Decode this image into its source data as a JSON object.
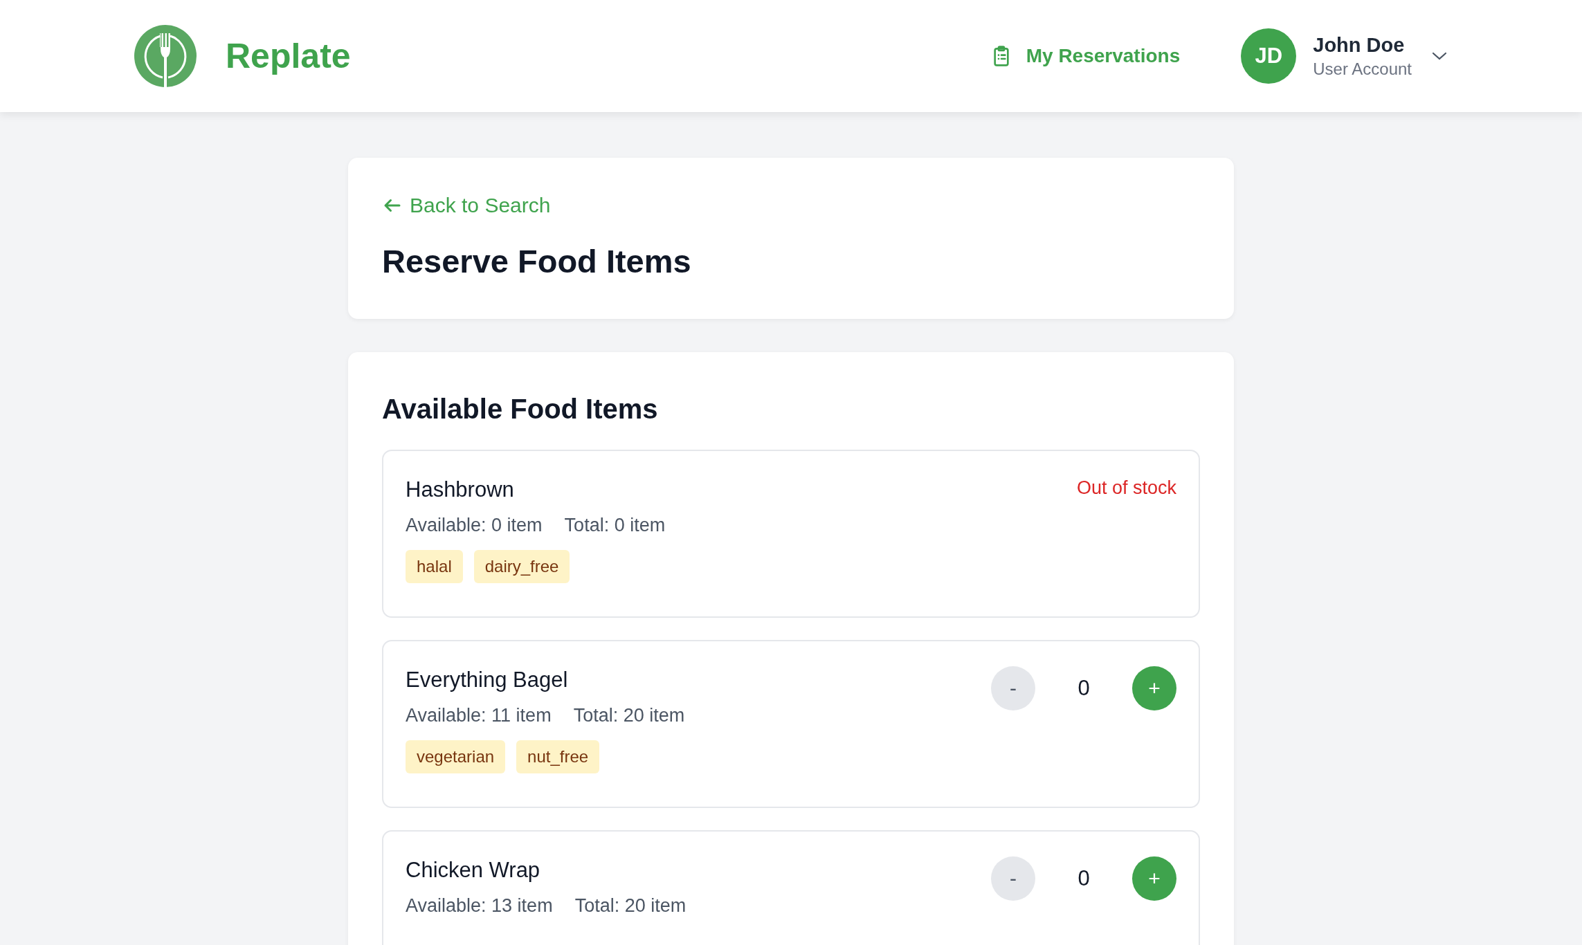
{
  "header": {
    "brand": "Replate",
    "nav_link": "My Reservations",
    "user": {
      "initials": "JD",
      "name": "John Doe",
      "role": "User Account"
    }
  },
  "page": {
    "back_link": "Back to Search",
    "title": "Reserve Food Items"
  },
  "food_section": {
    "title": "Available Food Items",
    "items": [
      {
        "kind": "out_of_stock",
        "name": "Hashbrown",
        "available": "Available: 0 item",
        "total": "Total: 0 item",
        "status": "Out of stock",
        "tags": [
          "halal",
          "dairy_free"
        ]
      },
      {
        "kind": "reservable",
        "name": "Everything Bagel",
        "available": "Available: 11 item",
        "total": "Total: 20 item",
        "minus": "-",
        "quantity": "0",
        "plus": "+",
        "tags": [
          "vegetarian",
          "nut_free"
        ]
      },
      {
        "kind": "reservable",
        "name": "Chicken Wrap",
        "available": "Available: 13 item",
        "total": "Total: 20 item",
        "minus": "-",
        "quantity": "0",
        "plus": "+"
      }
    ]
  }
}
